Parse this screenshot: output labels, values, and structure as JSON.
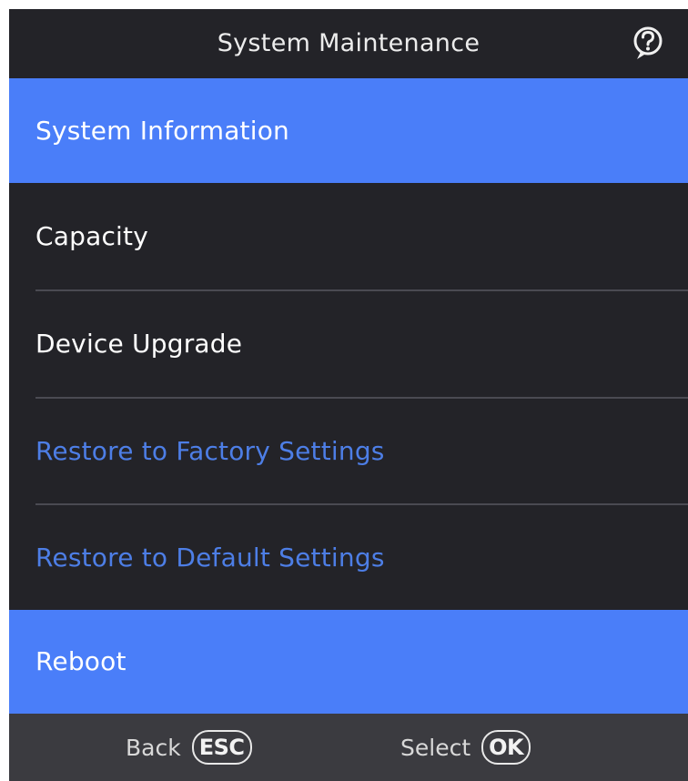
{
  "header": {
    "title": "System Maintenance",
    "help_icon": "question-circle-icon"
  },
  "menu": {
    "items": [
      {
        "label": "System Information",
        "state": "selected"
      },
      {
        "label": "Capacity",
        "state": "normal"
      },
      {
        "label": "Device Upgrade",
        "state": "normal"
      },
      {
        "label": "Restore to Factory Settings",
        "state": "disabled"
      },
      {
        "label": "Restore to Default Settings",
        "state": "disabled"
      },
      {
        "label": "Reboot",
        "state": "selected"
      }
    ]
  },
  "footer": {
    "back_label": "Back",
    "back_key": "ESC",
    "select_label": "Select",
    "select_key": "OK"
  },
  "colors": {
    "background": "#232328",
    "highlight": "#4a7ef9",
    "disabled_text": "#4d7ee6",
    "footer_background": "#3b3b40",
    "text": "#ffffff"
  }
}
